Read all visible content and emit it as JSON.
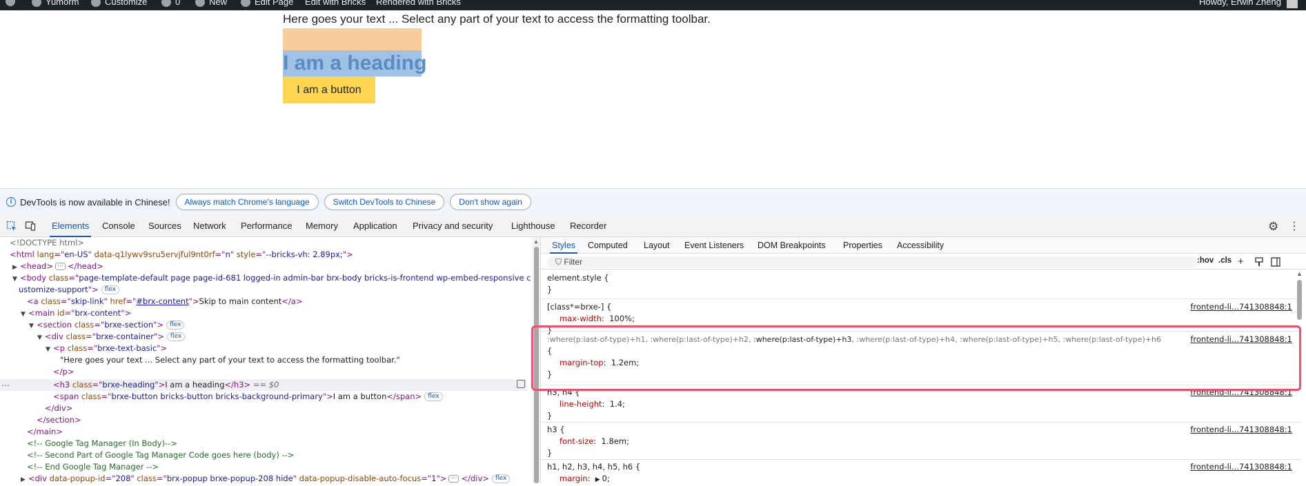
{
  "adminbar": {
    "items": [
      {
        "label": "Yumorm",
        "icon": "home-icon"
      },
      {
        "label": "Customize",
        "icon": "brush-icon"
      },
      {
        "label": "0",
        "icon": "comment-icon"
      },
      {
        "label": "New",
        "icon": "plus-icon"
      },
      {
        "label": "Edit Page",
        "icon": "pencil-icon"
      },
      {
        "label": "Edit with Bricks",
        "icon": ""
      },
      {
        "label": "Rendered with Bricks",
        "icon": ""
      }
    ],
    "greeting": "Howdy, Erwin Zheng"
  },
  "page": {
    "paragraph": "Here goes your text ... Select any part of your text to access the formatting toolbar.",
    "heading": "I am a heading",
    "button": "I am a button"
  },
  "infobar": {
    "message": "DevTools is now available in Chinese!",
    "buttons": [
      "Always match Chrome's language",
      "Switch DevTools to Chinese",
      "Don't show again"
    ]
  },
  "tabs": [
    "Elements",
    "Console",
    "Sources",
    "Network",
    "Performance",
    "Memory",
    "Application",
    "Privacy and security",
    "Lighthouse",
    "Recorder"
  ],
  "active_tab": "Elements",
  "dom": {
    "doctype": "<!DOCTYPE html>",
    "html_lang": "en-US",
    "html_attr": "data-q1lywv9sru5ervjful9nt0rf",
    "html_attr_val": "n",
    "html_style": "--bricks-vh: 2.89px;",
    "body_class_1": "page-template-default page page-id-681 logged-in admin-bar brx-body bricks-is-frontend wp-embed-responsive c",
    "body_class_2": "ustomize-support",
    "skip_href": "#brx-content",
    "skip_text": "Skip to main content",
    "main_id": "brx-content",
    "section_class": "brxe-section",
    "div_class": "brxe-container",
    "p_class": "brxe-text-basic",
    "p_text": "\"Here goes your text ... Select any part of your text to access the formatting toolbar.\"",
    "h3_class": "brxe-heading",
    "h3_text": "I am a heading",
    "dollar": "== $0",
    "span_class": "brxe-button bricks-button bricks-background-primary",
    "span_text": "I am a button",
    "comment1": "<!-- Google Tag Manager (In Body)-->",
    "comment2": "<!-- Second Part of Google Tag Manager Code goes here (body) -->",
    "comment3": "<!-- End Google Tag Manager -->",
    "popup_id": "208",
    "popup_class": "brx-popup brxe-popup-208 hide",
    "popup_attr": "data-popup-disable-auto-focus",
    "popup_attr_val": "1",
    "flex_badge": "flex"
  },
  "styles_tabs": [
    "Styles",
    "Computed",
    "Layout",
    "Event Listeners",
    "DOM Breakpoints",
    "Properties",
    "Accessibility"
  ],
  "filter": {
    "placeholder": "Filter",
    "hov": ":hov",
    "cls": ".cls"
  },
  "rules": {
    "element_style": "element.style {",
    "r1_selector": "[class*=brxe-] {",
    "r1_prop": "max-width",
    "r1_val": "100%;",
    "r2_sel_a": ":where(p:last-of-type)+h1, :where(p:last-of-type)+h2, ",
    "r2_sel_b": ":where(p:last-of-type)+h3",
    "r2_sel_c": ", :where(p:last-of-type)+h4, :where(p:last-of-type)+h5, :where(p:last-of-type)+h6",
    "r2_prop": "margin-top",
    "r2_val": "1.2em;",
    "r3_selector": "h3, h4 {",
    "r3_prop": "line-height",
    "r3_val": "1.4;",
    "r4_selector": "h3 {",
    "r4_prop": "font-size",
    "r4_val": "1.8em;",
    "r5_selector": "h1, h2, h3, h4, h5, h6 {",
    "r5_prop": "margin",
    "r5_val": "0;",
    "source": "frontend-li...741308848:1"
  },
  "colors": {
    "adminbar_bg": "#1d2327",
    "heading_bg": "#9fc2e6",
    "heading_margin": "#f9cc9d",
    "button_bg": "#ffd64f",
    "highlight": "#f0506e",
    "devtools_accent": "#0b57d0"
  }
}
